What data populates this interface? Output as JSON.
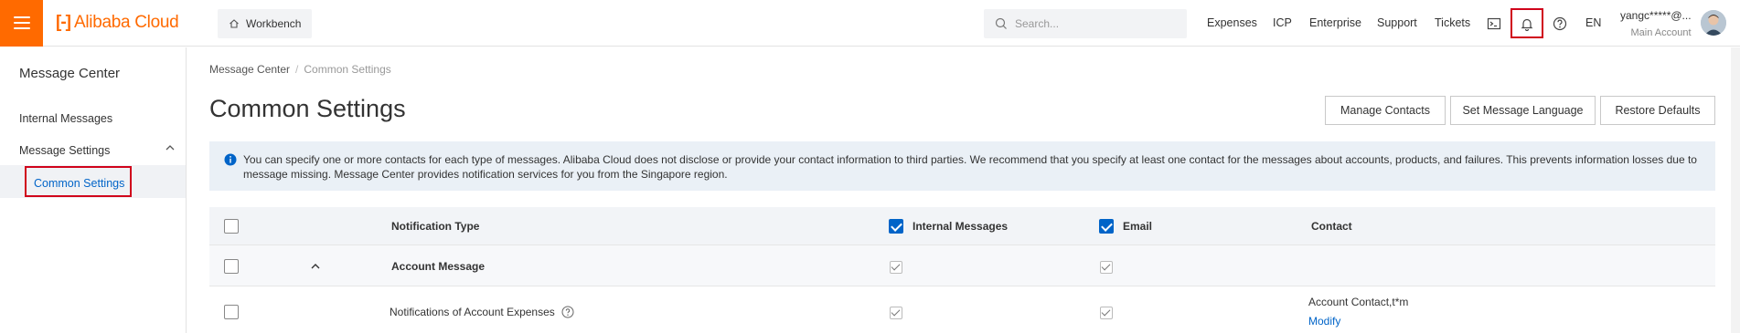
{
  "topbar": {
    "logo_mark": "[-]",
    "logo_text": "Alibaba Cloud",
    "workbench_label": "Workbench",
    "search_placeholder": "Search...",
    "nav": [
      "Expenses",
      "ICP",
      "Enterprise",
      "Support",
      "Tickets"
    ],
    "lang": "EN",
    "account_name": "yangc*****@...",
    "account_role": "Main Account"
  },
  "sidebar": {
    "title": "Message Center",
    "items": [
      {
        "label": "Internal Messages"
      },
      {
        "label": "Message Settings"
      },
      {
        "label": "Common Settings"
      }
    ]
  },
  "breadcrumb": {
    "root": "Message Center",
    "separator": "/",
    "current": "Common Settings"
  },
  "page": {
    "title": "Common Settings",
    "buttons": {
      "manage_contacts": "Manage Contacts",
      "set_language": "Set Message Language",
      "restore_defaults": "Restore Defaults"
    },
    "notice": "You can specify one or more contacts for each type of messages. Alibaba Cloud does not disclose or provide your contact information to third parties. We recommend that you specify at least one contact for the messages about accounts, products, and failures. This prevents information losses due to message missing. Message Center provides notification services for you from the Singapore region."
  },
  "table": {
    "columns": {
      "type": "Notification Type",
      "internal": "Internal Messages",
      "email": "Email",
      "contact": "Contact"
    },
    "group": {
      "label": "Account Message"
    },
    "rows": [
      {
        "type": "Notifications of Account Expenses",
        "contact": "Account Contact,t*m",
        "action": "Modify"
      }
    ]
  },
  "colors": {
    "brand": "#ff6a00",
    "link": "#0064c8",
    "highlight": "#d0021b"
  }
}
